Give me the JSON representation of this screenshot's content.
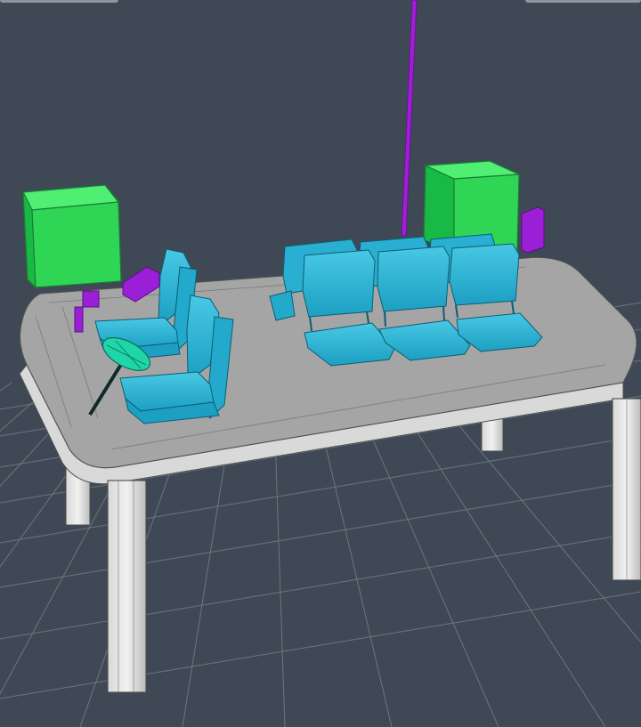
{
  "viewport": {
    "background": "#3f4955",
    "grid_color": "#6c7680"
  },
  "scene_objects": [
    {
      "name": "table",
      "color": "#d8d8d8"
    },
    {
      "name": "green-cube-left",
      "color": "#2fd655"
    },
    {
      "name": "green-cube-right",
      "color": "#2fd655"
    },
    {
      "name": "cyan-chairs",
      "color": "#2fb6d8"
    },
    {
      "name": "purple-blocks",
      "color": "#9b1fd6"
    },
    {
      "name": "magenta-vertical-line",
      "color": "#a01fd6"
    },
    {
      "name": "green-disc",
      "color": "#1fd6a8"
    }
  ]
}
